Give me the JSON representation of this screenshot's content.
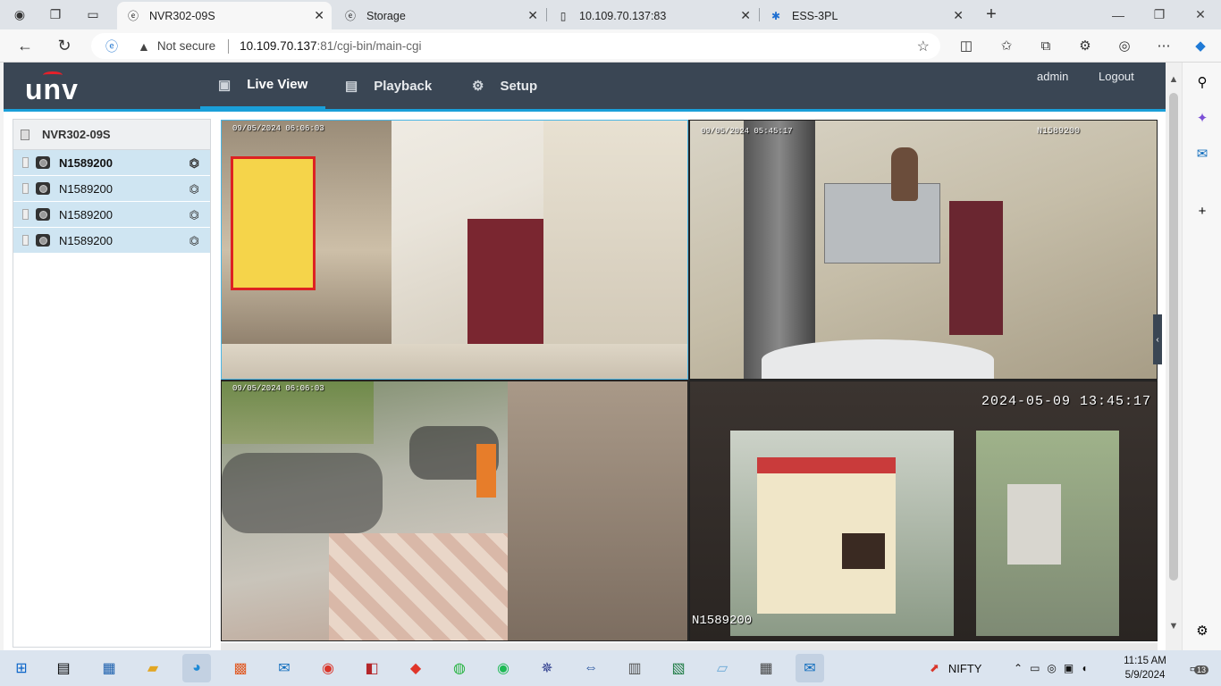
{
  "browser": {
    "tabs": [
      {
        "title": "NVR302-09S",
        "active": true
      },
      {
        "title": "Storage",
        "active": false
      },
      {
        "title": "10.109.70.137:83",
        "active": false
      },
      {
        "title": "ESS-3PL",
        "active": false
      }
    ],
    "address": {
      "security_label": "Not secure",
      "host": "10.109.70.137",
      "path": ":81/cgi-bin/main-cgi"
    }
  },
  "app": {
    "logo": "unv",
    "nav": [
      {
        "label": "Live View",
        "active": true,
        "icon": "monitor-icon"
      },
      {
        "label": "Playback",
        "active": false,
        "icon": "film-icon"
      },
      {
        "label": "Setup",
        "active": false,
        "icon": "gear-icon"
      }
    ],
    "user": "admin",
    "logout": "Logout"
  },
  "device_tree": {
    "root": "NVR302-09S",
    "cameras": [
      {
        "name": "N1589200",
        "selected": true
      },
      {
        "name": "N1589200",
        "selected": false
      },
      {
        "name": "N1589200",
        "selected": false
      },
      {
        "name": "N1589200",
        "selected": false
      }
    ]
  },
  "video_tiles": [
    {
      "timestamp": "09/05/2024 06:06:03",
      "channel": "",
      "selected": true
    },
    {
      "timestamp": "09/05/2024 05:45:17",
      "channel": "N1589200",
      "selected": false
    },
    {
      "timestamp": "09/05/2024 06:06:03",
      "channel": "",
      "selected": false
    },
    {
      "timestamp": "2024-05-09 13:45:17",
      "channel": "N1589200",
      "selected": false
    }
  ],
  "taskbar": {
    "stock_label": "NIFTY",
    "time": "11:15 AM",
    "date": "5/9/2024",
    "notification_count": "13"
  },
  "colors": {
    "header_bg": "#3a4654",
    "accent": "#1a9fd9",
    "tree_selected_bg": "#cfe5f2"
  }
}
